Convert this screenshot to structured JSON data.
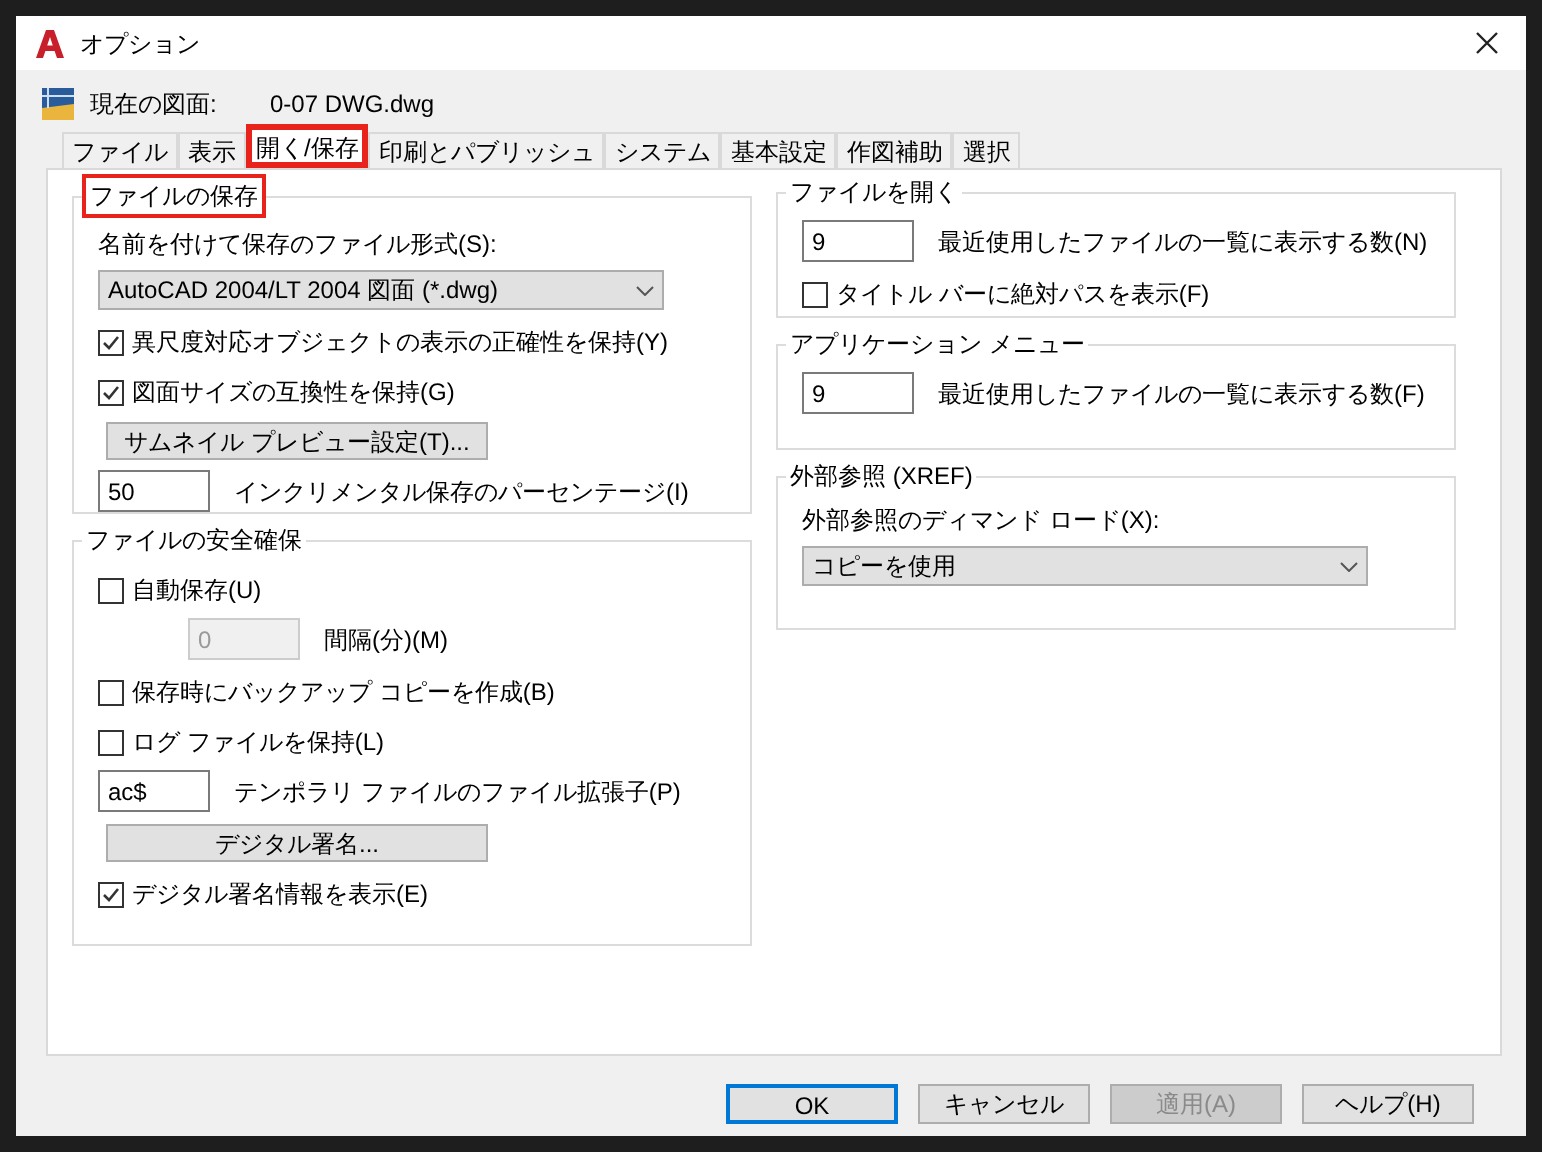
{
  "window": {
    "title": "オプション"
  },
  "current_drawing": {
    "label": "現在の図面:",
    "value": "0-07 DWG.dwg"
  },
  "tabs": [
    {
      "label": "ファイル",
      "selected": false,
      "highlighted": false
    },
    {
      "label": "表示",
      "selected": false,
      "highlighted": false
    },
    {
      "label": "開く/保存",
      "selected": true,
      "highlighted": true
    },
    {
      "label": "印刷とパブリッシュ",
      "selected": false,
      "highlighted": false
    },
    {
      "label": "システム",
      "selected": false,
      "highlighted": false
    },
    {
      "label": "基本設定",
      "selected": false,
      "highlighted": false
    },
    {
      "label": "作図補助",
      "selected": false,
      "highlighted": false
    },
    {
      "label": "選択",
      "selected": false,
      "highlighted": false
    }
  ],
  "left_sections": [
    {
      "title": "ファイルの保存",
      "highlighted": true,
      "items": [
        {
          "kind": "label",
          "text": "名前を付けて保存のファイル形式(S):"
        },
        {
          "kind": "dropdown",
          "value": "AutoCAD 2004/LT 2004 図面 (*.dwg)"
        },
        {
          "kind": "checkbox",
          "label": "異尺度対応オブジェクトの表示の正確性を保持(Y)",
          "checked": true
        },
        {
          "kind": "checkbox",
          "label": "図面サイズの互換性を保持(G)",
          "checked": true
        },
        {
          "kind": "button",
          "label": "サムネイル プレビュー設定(T)..."
        },
        {
          "kind": "field",
          "value": "50",
          "text": "インクリメンタル保存のパーセンテージ(I)",
          "disabled": false
        }
      ]
    },
    {
      "title": "ファイルの安全確保",
      "highlighted": false,
      "items": [
        {
          "kind": "checkbox",
          "label": "自動保存(U)",
          "checked": false
        },
        {
          "kind": "field",
          "value": "0",
          "text": "間隔(分)(M)",
          "disabled": true
        },
        {
          "kind": "checkbox",
          "label": "保存時にバックアップ コピーを作成(B)",
          "checked": false
        },
        {
          "kind": "checkbox",
          "label": "ログ ファイルを保持(L)",
          "checked": false
        },
        {
          "kind": "field",
          "value": "ac$",
          "text": "テンポラリ ファイルのファイル拡張子(P)",
          "disabled": false
        },
        {
          "kind": "button",
          "label": "デジタル署名..."
        },
        {
          "kind": "checkbox",
          "label": "デジタル署名情報を表示(E)",
          "checked": true
        }
      ]
    }
  ],
  "right_sections": [
    {
      "title": "ファイルを開く",
      "highlighted": false,
      "items": [
        {
          "kind": "field",
          "value": "9",
          "text": "最近使用したファイルの一覧に表示する数(N)",
          "disabled": false
        },
        {
          "kind": "checkbox",
          "label": "タイトル バーに絶対パスを表示(F)",
          "checked": false
        }
      ]
    },
    {
      "title": "アプリケーション メニュー",
      "highlighted": false,
      "items": [
        {
          "kind": "field",
          "value": "9",
          "text": "最近使用したファイルの一覧に表示する数(F)",
          "disabled": false
        }
      ]
    },
    {
      "title": "外部参照 (XREF)",
      "highlighted": false,
      "items": [
        {
          "kind": "label",
          "text": "外部参照のディマンド ロード(X):"
        },
        {
          "kind": "dropdown",
          "value": "コピーを使用"
        }
      ]
    }
  ],
  "buttons": [
    {
      "label": "OK",
      "default": true,
      "disabled": false
    },
    {
      "label": "キャンセル",
      "default": false,
      "disabled": false
    },
    {
      "label": "適用(A)",
      "default": false,
      "disabled": true
    },
    {
      "label": "ヘルプ(H)",
      "default": false,
      "disabled": false
    }
  ]
}
